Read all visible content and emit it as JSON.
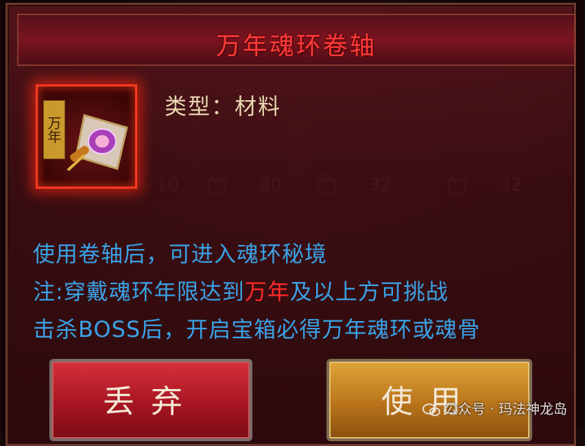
{
  "dialog": {
    "title": "万年魂环卷轴",
    "item_badge": "万年",
    "type_label": "类型：材料",
    "description": {
      "line1": "使用卷轴后，可进入魂环秘境",
      "line2_pre": "注:穿戴魂环年限达到",
      "line2_highlight": "万年",
      "line2_post": "及以上方可挑战",
      "line3": "击杀BOSS后，开启宝箱必得万年魂环或魂骨"
    },
    "buttons": {
      "discard": "丢弃",
      "use": "使用"
    }
  },
  "background_slots": [
    {
      "count": "10"
    },
    {
      "count": "80"
    },
    {
      "count": "32"
    },
    {
      "count": "32"
    }
  ],
  "watermark": "公众号 · 玛法神龙岛",
  "colors": {
    "title": "#ff3b3b",
    "description": "#3aa2e6",
    "highlight": "#ff2a2a",
    "type_text": "#e8d7b0",
    "discard_button": "#b01a26",
    "use_button": "#c27c1f"
  }
}
